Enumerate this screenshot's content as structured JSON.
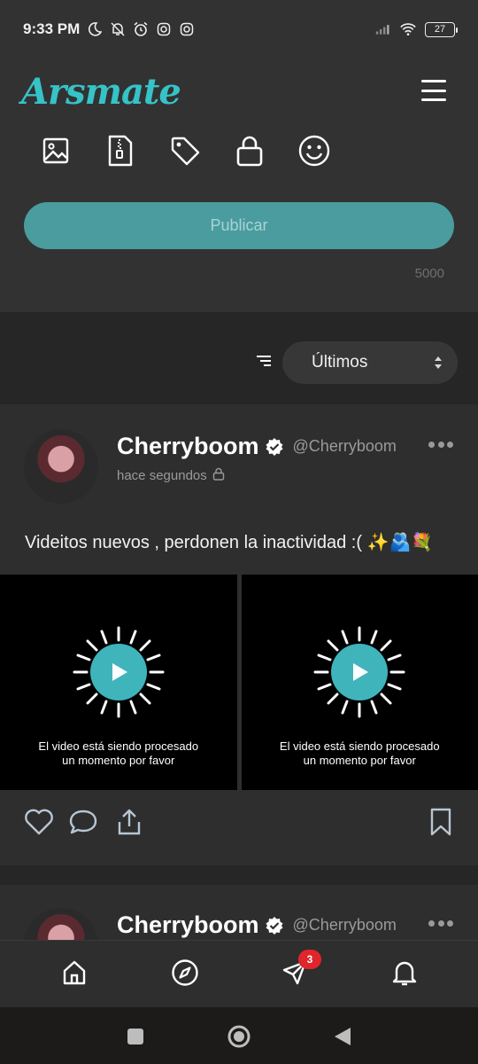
{
  "status_bar": {
    "time": "9:33 PM",
    "icons_left": [
      "moon-icon",
      "muted-bell-icon",
      "alarm-icon",
      "instagram-icon",
      "instagram-icon"
    ],
    "icons_right": [
      "signal-icon",
      "wifi-icon"
    ],
    "battery": "27"
  },
  "header": {
    "logo": "Arsmate",
    "menu_icon": "hamburger-icon"
  },
  "composer": {
    "tools": [
      "image-icon",
      "zip-file-icon",
      "tag-icon",
      "lock-icon",
      "smiley-icon"
    ],
    "publish_label": "Publicar",
    "char_counter": "5000"
  },
  "filter": {
    "sort_icon": "sort-lines-icon",
    "selected": "Últimos"
  },
  "posts": [
    {
      "author_name": "Cherryboom",
      "handle": "@Cherryboom",
      "time": "hace segundos",
      "text": "Videitos nuevos , perdonen la inactividad :( ✨🫂💐",
      "videos": [
        {
          "message_line1": "El video está siendo procesado",
          "message_line2": "un momento por favor"
        },
        {
          "message_line1": "El video está siendo procesado",
          "message_line2": "un momento por favor"
        }
      ]
    },
    {
      "author_name": "Cherryboom",
      "handle": "@Cherryboom"
    }
  ],
  "bottom_nav": {
    "items": [
      "home-icon",
      "compass-icon",
      "send-icon",
      "bell-icon"
    ],
    "messages_badge": "3"
  },
  "colors": {
    "accent": "#36c3c8",
    "publish_bg": "#4a9c9f",
    "badge": "#e0252b",
    "background": "#2e2e2e"
  }
}
